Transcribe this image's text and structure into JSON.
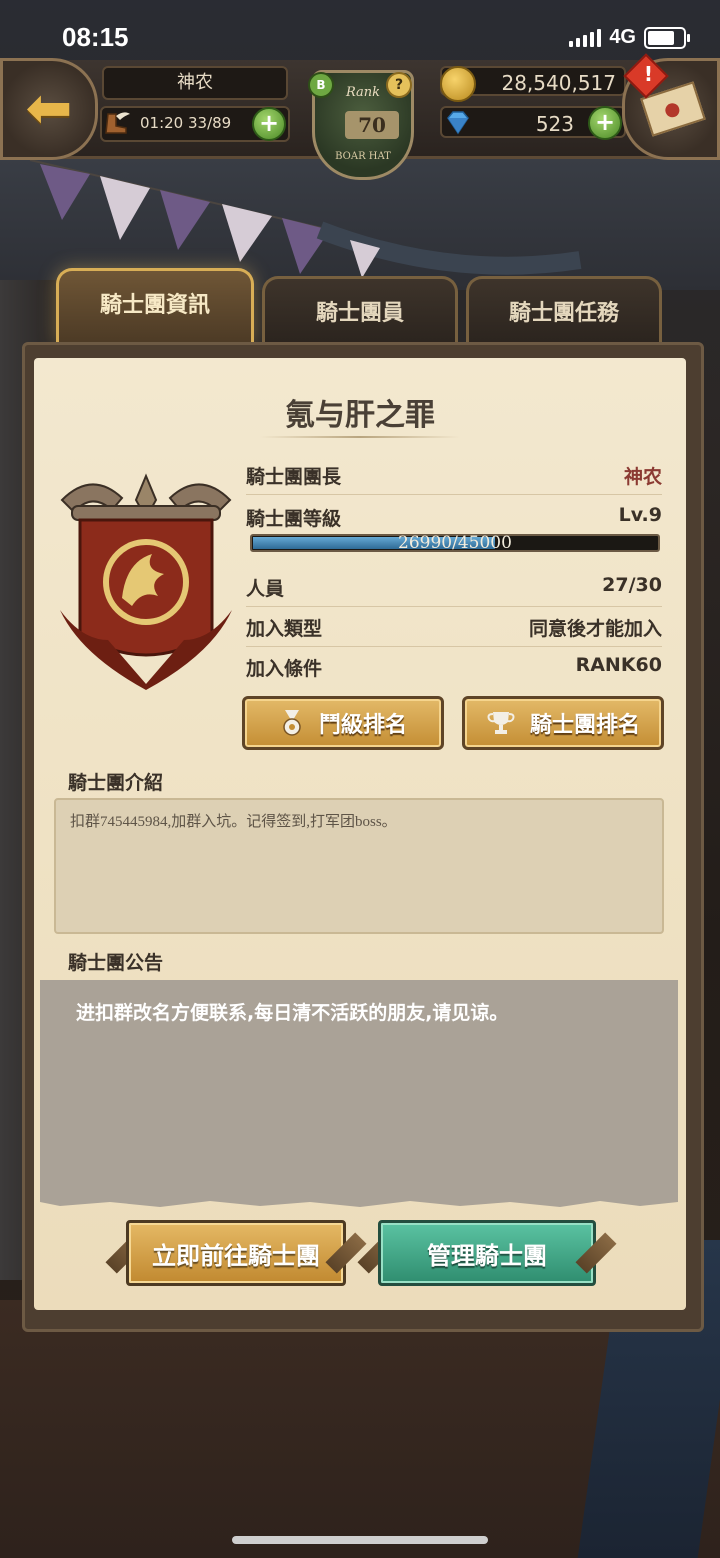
{
  "status_bar": {
    "time": "08:15",
    "network": "4G"
  },
  "hud": {
    "player_name": "神农",
    "stamina": "01:20 33/89",
    "rank_label": "Rank",
    "rank_value": "70",
    "rank_sub": "BOAR HAT",
    "rank_b": "B",
    "rank_q": "?",
    "gold": "28,540,517",
    "gems": "523",
    "plus": "+",
    "alert": "!"
  },
  "tabs": [
    {
      "label": "騎士團資訊",
      "active": true
    },
    {
      "label": "騎士團員",
      "active": false
    },
    {
      "label": "騎士團任務",
      "active": false
    }
  ],
  "guild": {
    "name": "氪与肝之罪",
    "rows": [
      {
        "label": "騎士團團長",
        "value": "神农"
      },
      {
        "label": "騎士團等級",
        "value": "Lv.9"
      },
      {
        "label": "人員",
        "value": "27/30"
      },
      {
        "label": "加入類型",
        "value": "同意後才能加入"
      },
      {
        "label": "加入條件",
        "value": "RANK60"
      }
    ],
    "xp_text": "26990/45000",
    "xp_current": 26990,
    "xp_max": 45000
  },
  "buttons": {
    "fight_rank": "鬥級排名",
    "guild_rank": "騎士團排名",
    "go_to_guild": "立即前往騎士團",
    "manage_guild": "管理騎士團"
  },
  "sections": {
    "intro_title": "騎士團介紹",
    "intro_text": "扣群745445984,加群入坑。记得签到,打军团boss。",
    "notice_title": "騎士團公告",
    "notice_text": "进扣群改名方便联系,每日清不活跃的朋友,请见谅。"
  },
  "colors": {
    "tab_active": "#6f5636",
    "parchment": "#f3e8cf",
    "gold_button": "#e3b968",
    "green_button": "#5bc3a2",
    "xp_fill": "#66a9d4",
    "leader_name": "#8b3a32"
  }
}
